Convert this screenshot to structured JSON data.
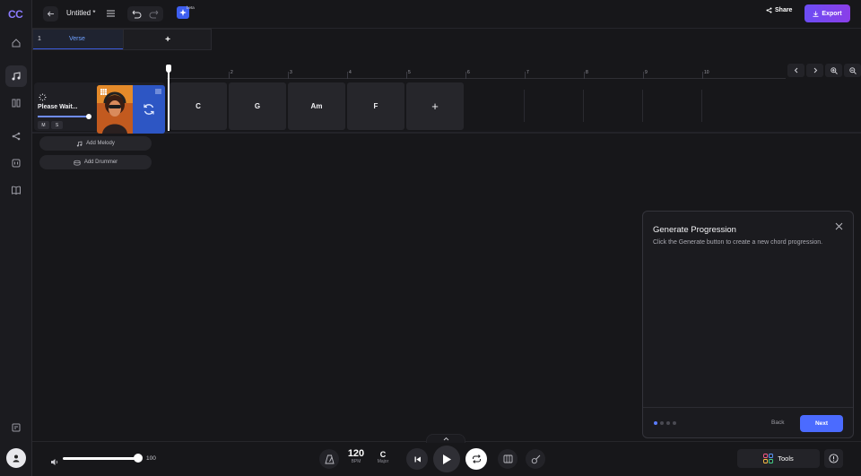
{
  "app": {
    "logo": "CC",
    "title": "Untitled *",
    "beta": "beta"
  },
  "topbar": {
    "share_label": "Share",
    "export_label": "Export"
  },
  "sections": [
    {
      "number": "1",
      "name": "Verse"
    }
  ],
  "section_add": "+",
  "ruler": {
    "numbers": [
      "2",
      "3",
      "4",
      "5",
      "6",
      "7",
      "8",
      "9",
      "10"
    ]
  },
  "track": {
    "status": "Please Wait...",
    "mute": "M",
    "solo": "S"
  },
  "chords": [
    "C",
    "G",
    "Am",
    "F"
  ],
  "chord_add": "+",
  "actions": {
    "add_melody": "Add Melody",
    "add_drummer": "Add Drummer"
  },
  "panel": {
    "title": "Generate Progression",
    "description": "Click the Generate button to create a new chord progression.",
    "back": "Back",
    "next": "Next",
    "step": 1,
    "steps": 4
  },
  "transport": {
    "volume": "100",
    "volume_level": 1.0,
    "bpm": "120",
    "bpm_label": "BPM",
    "key": "C",
    "key_label": "Major",
    "tools_label": "Tools"
  },
  "colors": {
    "accent": "#4b6bff",
    "export": "#7b45ef",
    "logo": "#8b7bff"
  }
}
